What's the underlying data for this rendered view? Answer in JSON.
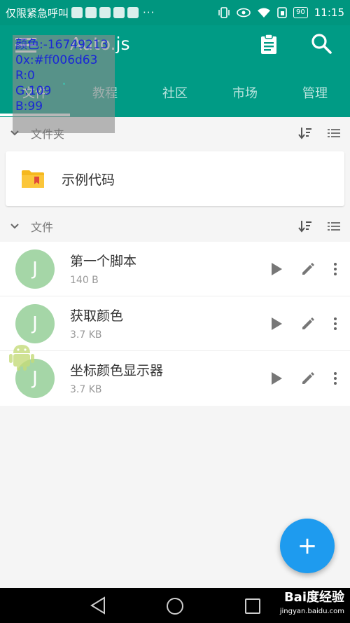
{
  "status_bar": {
    "carrier_text": "仅限紧急呼叫",
    "more": "···",
    "battery": "90",
    "time": "11:15"
  },
  "app_bar": {
    "title": "Auto.js",
    "tabs": [
      {
        "label": "文件",
        "active": true
      },
      {
        "label": "教程",
        "active": false
      },
      {
        "label": "社区",
        "active": false
      },
      {
        "label": "市场",
        "active": false
      },
      {
        "label": "管理",
        "active": false
      }
    ],
    "color": "#009b85"
  },
  "color_overlay": {
    "line1": "颜色:-16749213",
    "line2": "0x:#ff006d63",
    "line3": "R:0",
    "line4": "G:109",
    "line5": "B:99"
  },
  "sections": {
    "folders_label": "文件夹",
    "files_label": "文件"
  },
  "folders": [
    {
      "name": "示例代码"
    }
  ],
  "files": [
    {
      "avatar": "J",
      "name": "第一个脚本",
      "size": "140 B"
    },
    {
      "avatar": "J",
      "name": "获取颜色",
      "size": "3.7 KB"
    },
    {
      "avatar": "J",
      "name": "坐标颜色显示器",
      "size": "3.7 KB"
    }
  ],
  "fab": {
    "label": "+",
    "color": "#1e9bef"
  },
  "watermark": {
    "main": "Bai度经验",
    "sub": "jingyan.baidu.com"
  }
}
